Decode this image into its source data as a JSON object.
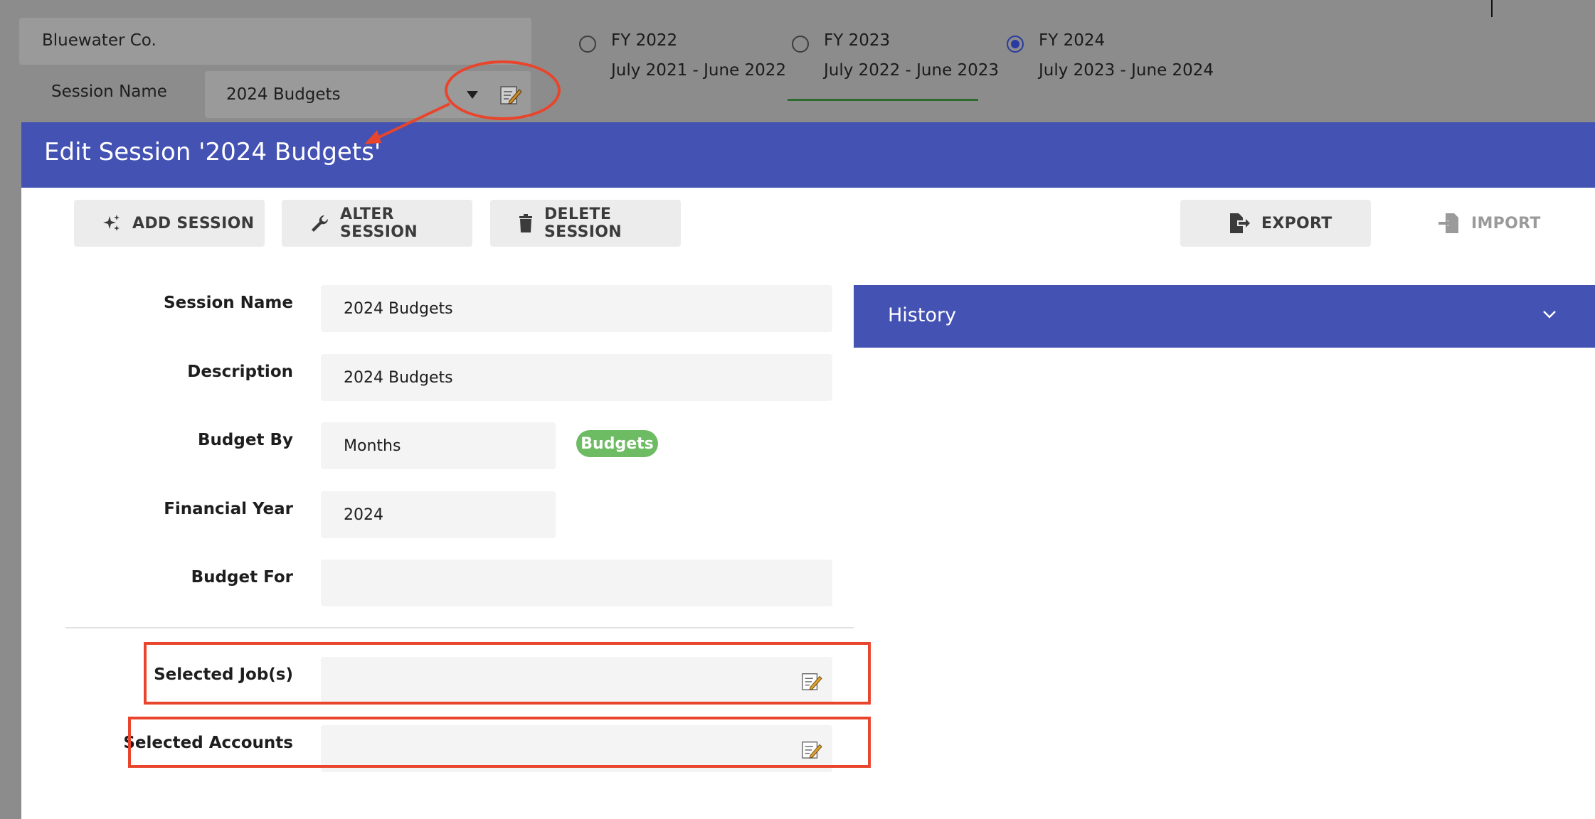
{
  "background": {
    "company": "Bluewater Co.",
    "session_label": "Session Name",
    "session_value": "2024 Budgets",
    "fiscal_years": [
      {
        "title": "FY 2022",
        "range": "July 2021 - June 2022",
        "selected": false
      },
      {
        "title": "FY 2023",
        "range": "July 2022 - June 2023",
        "selected": false
      },
      {
        "title": "FY 2024",
        "range": "July 2023 - June 2024",
        "selected": true
      }
    ]
  },
  "modal": {
    "title": "Edit Session '2024 Budgets'",
    "toolbar": {
      "add": "ADD SESSION",
      "alter": "ALTER SESSION",
      "delete": "DELETE SESSION",
      "export": "EXPORT",
      "import": "IMPORT"
    },
    "fields": {
      "session_name": {
        "label": "Session Name",
        "value": "2024 Budgets"
      },
      "description": {
        "label": "Description",
        "value": "2024 Budgets"
      },
      "budget_by": {
        "label": "Budget By",
        "value": "Months",
        "badge": "Budgets"
      },
      "financial_year": {
        "label": "Financial Year",
        "value": "2024"
      },
      "budget_for": {
        "label": "Budget For",
        "value": ""
      },
      "selected_jobs": {
        "label": "Selected Job(s)",
        "value": ""
      },
      "selected_accounts": {
        "label": "Selected Accounts",
        "value": ""
      }
    },
    "history": {
      "title": "History"
    }
  },
  "colors": {
    "header": "#4352b3",
    "badge": "#6dbb62",
    "annotation": "#e8452c",
    "overlay": "#8c8c8c"
  },
  "icons": {
    "add": "sparkle-icon",
    "alter": "wrench-icon",
    "delete": "trash-icon",
    "export": "export-file-icon",
    "import": "import-file-icon",
    "edit": "edit-note-icon",
    "history_toggle": "chevron-down-icon"
  }
}
